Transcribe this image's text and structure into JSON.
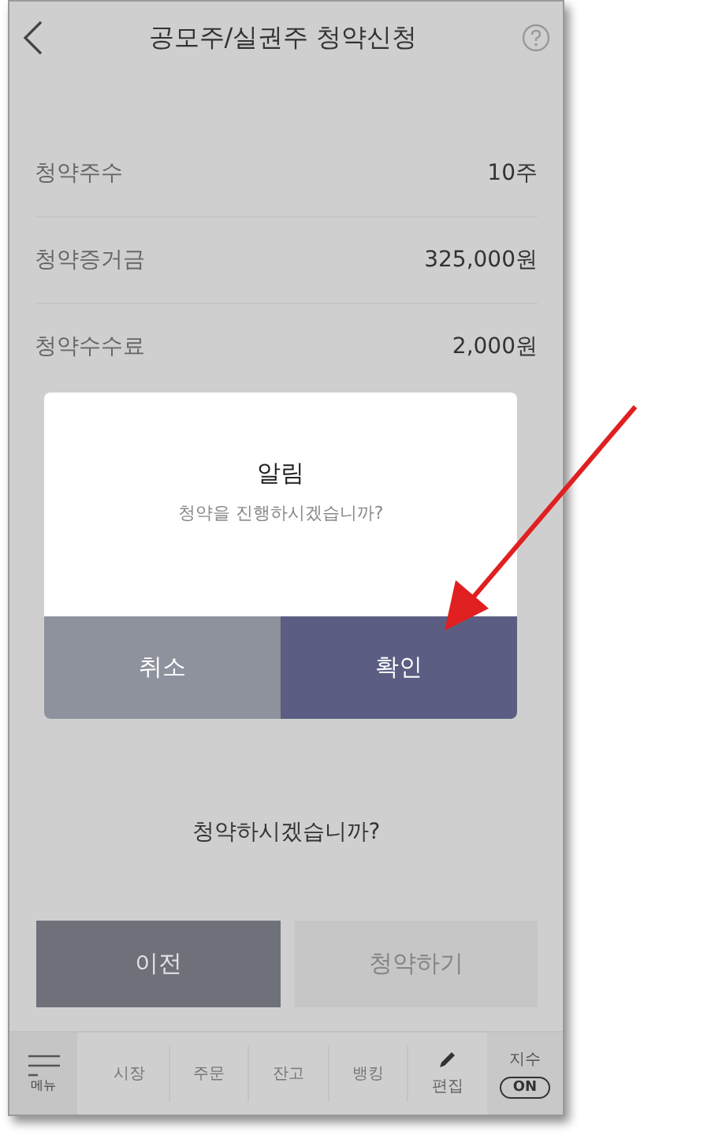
{
  "header": {
    "title": "공모주/실권주 청약신청"
  },
  "rows": [
    {
      "label": "청약주수",
      "value": "10주"
    },
    {
      "label": "청약증거금",
      "value": "325,000원"
    },
    {
      "label": "청약수수료",
      "value": "2,000원"
    }
  ],
  "dialog": {
    "title": "알림",
    "message": "청약을 진행하시겠습니까?",
    "buttons": [
      {
        "label": "취소",
        "kind": "cancel"
      },
      {
        "label": "확인",
        "kind": "confirm"
      }
    ]
  },
  "prompt": "청약하시겠습니까?",
  "actions": [
    {
      "label": "이전",
      "disabled": false
    },
    {
      "label": "청약하기",
      "disabled": true
    }
  ],
  "bottom_nav": {
    "menu": "메뉴",
    "items": [
      "시장",
      "주문",
      "잔고",
      "뱅킹"
    ],
    "edit": "편집",
    "index": {
      "label": "지수",
      "toggle": "ON",
      "on": true
    }
  }
}
